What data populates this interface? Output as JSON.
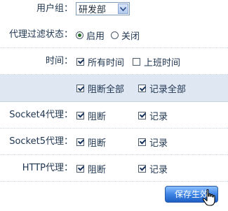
{
  "group": {
    "label": "用户组：",
    "selected": "研发部"
  },
  "proxy_filter": {
    "label": "代理过滤状态：",
    "options": [
      "启用",
      "关闭"
    ],
    "selected": "启用"
  },
  "time": {
    "label": "时间：",
    "all_time": "所有时间",
    "work_time": "上班时间",
    "all_time_checked": true,
    "work_time_checked": false
  },
  "select_all": {
    "block_all": "阻断全部",
    "record_all": "记录全部"
  },
  "proxies": [
    {
      "label": "Socket4代理：",
      "block": "阻断",
      "record": "记录"
    },
    {
      "label": "Socket5代理：",
      "block": "阻断",
      "record": "记录"
    },
    {
      "label": "HTTP代理：",
      "block": "阻断",
      "record": "记录"
    }
  ],
  "save_button": {
    "label": "保存生效"
  }
}
